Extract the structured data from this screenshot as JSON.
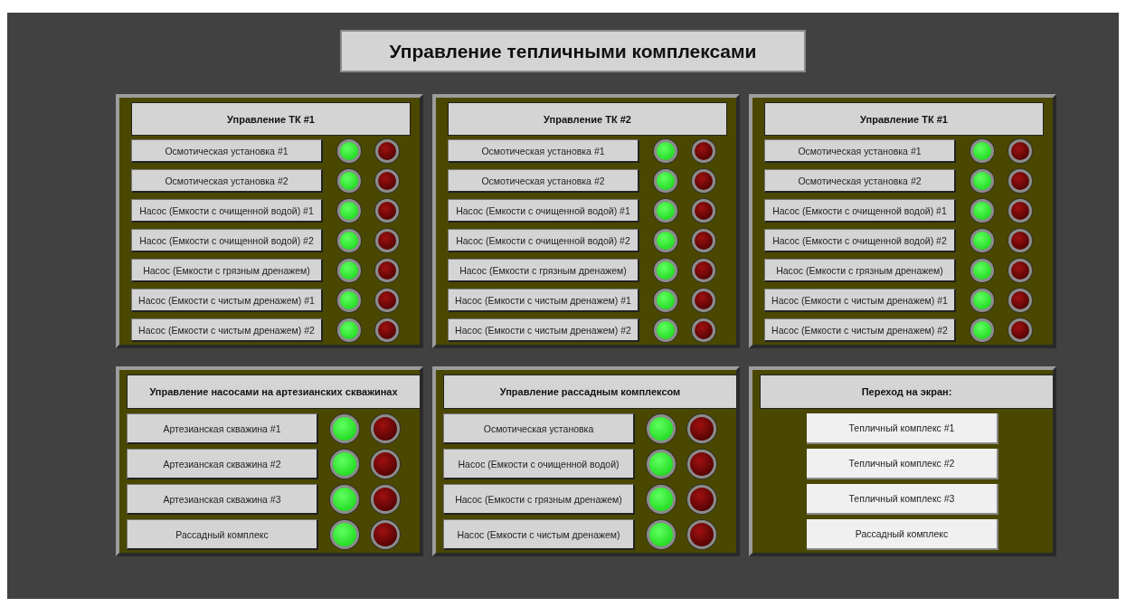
{
  "title": "Управление тепличными комплексами",
  "panel_rows": [
    [
      {
        "kind": "lamps",
        "header": "Управление ТК #1",
        "rows": [
          {
            "label": "Осмотическая установка #1",
            "running": true
          },
          {
            "label": "Осмотическая установка #2",
            "running": true
          },
          {
            "label": "Насос (Емкости с очищенной водой) #1",
            "running": true
          },
          {
            "label": "Насос (Емкости с очищенной водой) #2",
            "running": true
          },
          {
            "label": "Насос (Емкости с грязным дренажем)",
            "running": true
          },
          {
            "label": "Насос (Емкости с чистым дренажем) #1",
            "running": true
          },
          {
            "label": "Насос (Емкости с чистым дренажем) #2",
            "running": true
          }
        ]
      },
      {
        "kind": "lamps",
        "header": "Управление ТК #2",
        "rows": [
          {
            "label": "Осмотическая установка #1",
            "running": true
          },
          {
            "label": "Осмотическая установка #2",
            "running": true
          },
          {
            "label": "Насос (Емкости с очищенной водой) #1",
            "running": true
          },
          {
            "label": "Насос (Емкости с очищенной водой) #2",
            "running": true
          },
          {
            "label": "Насос (Емкости с грязным дренажем)",
            "running": true
          },
          {
            "label": "Насос (Емкости с чистым дренажем) #1",
            "running": true
          },
          {
            "label": "Насос (Емкости с чистым дренажем) #2",
            "running": true
          }
        ]
      },
      {
        "kind": "lamps",
        "header": "Управление ТК #1",
        "rows": [
          {
            "label": "Осмотическая установка #1",
            "running": true
          },
          {
            "label": "Осмотическая установка #2",
            "running": true
          },
          {
            "label": "Насос (Емкости с очищенной водой) #1",
            "running": true
          },
          {
            "label": "Насос (Емкости с очищенной водой) #2",
            "running": true
          },
          {
            "label": "Насос (Емкости с грязным дренажем)",
            "running": true
          },
          {
            "label": "Насос (Емкости с чистым дренажем) #1",
            "running": true
          },
          {
            "label": "Насос (Емкости с чистым дренажем) #2",
            "running": true
          }
        ]
      }
    ],
    [
      {
        "kind": "lamps",
        "header": "Управление насосами на артезианских скважинах",
        "rows": [
          {
            "label": "Артезианская скважина #1",
            "running": true
          },
          {
            "label": "Артезианская скважина #2",
            "running": true
          },
          {
            "label": "Артезианская скважина #3",
            "running": true
          },
          {
            "label": "Рассадный комплекс",
            "running": true
          }
        ]
      },
      {
        "kind": "lamps",
        "header": "Управление рассадным комплексом",
        "rows": [
          {
            "label": "Осмотическая установка",
            "running": true
          },
          {
            "label": "Насос (Емкости с очищенной водой)",
            "running": true
          },
          {
            "label": "Насос (Емкости с грязным дренажем)",
            "running": true
          },
          {
            "label": "Насос (Емкости с чистым дренажем)",
            "running": true
          }
        ]
      },
      {
        "kind": "nav",
        "header": "Переход на экран:",
        "buttons": [
          "Тепличный комплекс #1",
          "Тепличный комплекс #2",
          "Тепличный комплекс #3",
          "Рассадный комплекс"
        ]
      }
    ]
  ]
}
